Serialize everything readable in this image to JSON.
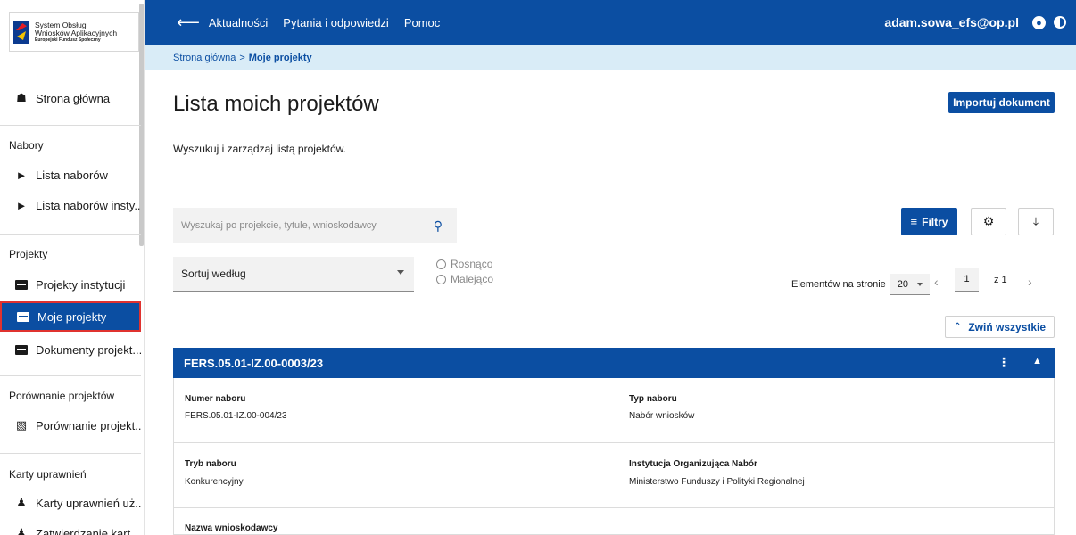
{
  "app": {
    "logo": {
      "line1": "System Obsługi",
      "line2": "Wniosków Aplikacyjnych",
      "line3": "Europejski Fundusz Społeczny"
    }
  },
  "topbar": {
    "links": [
      "Aktualności",
      "Pytania i odpowiedzi",
      "Pomoc"
    ],
    "user": "adam.sowa_efs@op.pl"
  },
  "breadcrumb": {
    "home": "Strona główna",
    "separator": ">",
    "current": "Moje projekty"
  },
  "sidebar": {
    "home": "Strona główna",
    "sections": [
      {
        "label": "Nabory",
        "items": [
          "Lista naborów",
          "Lista naborów insty..."
        ]
      },
      {
        "label": "Projekty",
        "items": [
          "Projekty instytucji",
          "Moje projekty",
          "Dokumenty projekt..."
        ]
      },
      {
        "label": "Porównanie projektów",
        "items": [
          "Porównanie projekt..."
        ]
      },
      {
        "label": "Karty uprawnień",
        "items": [
          "Karty uprawnień uż...",
          "Zatwierdzanie kart..."
        ]
      }
    ],
    "active_item": "Moje projekty"
  },
  "main": {
    "title": "Lista moich projektów",
    "import_button": "Importuj dokument",
    "subtitle": "Wyszukuj i zarządzaj listą projektów.",
    "search_placeholder": "Wyszukaj po projekcie, tytule, wnioskodawcy",
    "filters_button": "Filtry",
    "sort_label": "Sortuj według",
    "radio_asc": "Rosnąco",
    "radio_desc": "Malejąco",
    "per_page_label": "Elementów na stronie",
    "per_page_value": "20",
    "page_current": "1",
    "page_of": "z 1",
    "collapse_all": "Zwiń wszystkie"
  },
  "project_card": {
    "title": "FERS.05.01-IZ.00-0003/23",
    "fields": [
      {
        "label": "Numer naboru",
        "value": "FERS.05.01-IZ.00-004/23"
      },
      {
        "label": "Typ naboru",
        "value": "Nabór wniosków"
      },
      {
        "label": "Tryb naboru",
        "value": "Konkurencyjny"
      },
      {
        "label": "Instytucja Organizująca Nabór",
        "value": "Ministerstwo Funduszy i Polityki Regionalnej"
      },
      {
        "label": "Nazwa wnioskodawcy",
        "value": ""
      }
    ]
  },
  "colors": {
    "primary": "#0b4ea2",
    "breadcrumb_bg": "#d9ecf7",
    "active_outline": "#e0322f"
  }
}
